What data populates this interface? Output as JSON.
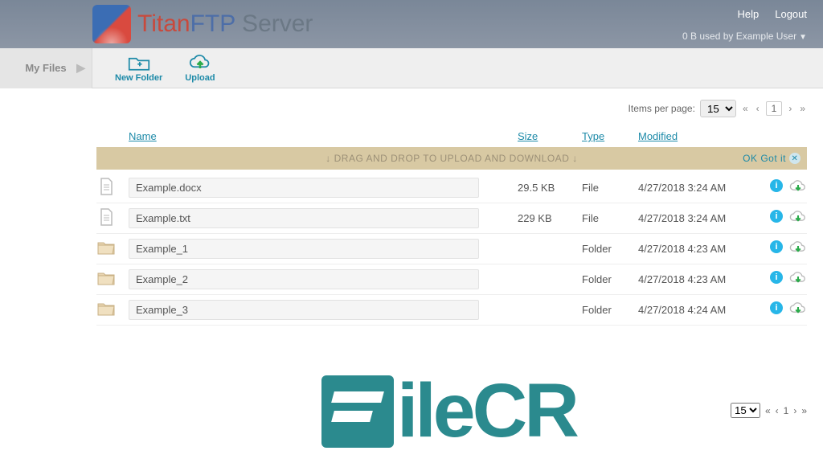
{
  "header": {
    "brand_red": "Titan",
    "brand_blue": "FTP",
    "brand_gray": " Server",
    "help": "Help",
    "logout": "Logout",
    "usage_prefix": "0 B used by ",
    "username": "Example User"
  },
  "sidebar": {
    "my_files": "My Files"
  },
  "toolbar": {
    "new_folder": "New Folder",
    "upload": "Upload"
  },
  "pager": {
    "label": "Items per page:",
    "value": "15",
    "first": "«",
    "prev": "‹",
    "current": "1",
    "next": "›",
    "last": "»"
  },
  "columns": {
    "name": "Name",
    "size": "Size",
    "type": "Type",
    "modified": "Modified"
  },
  "banner": {
    "text": "↓ DRAG AND DROP TO UPLOAD AND DOWNLOAD ↓",
    "ok": "OK Got it"
  },
  "rows": [
    {
      "icon": "file",
      "name": "Example.docx",
      "size": "29.5 KB",
      "type": "File",
      "modified": "4/27/2018 3:24 AM"
    },
    {
      "icon": "file",
      "name": "Example.txt",
      "size": "229 KB",
      "type": "File",
      "modified": "4/27/2018 3:24 AM"
    },
    {
      "icon": "folder",
      "name": "Example_1",
      "size": "",
      "type": "Folder",
      "modified": "4/27/2018 4:23 AM"
    },
    {
      "icon": "folder",
      "name": "Example_2",
      "size": "",
      "type": "Folder",
      "modified": "4/27/2018 4:23 AM"
    },
    {
      "icon": "folder",
      "name": "Example_3",
      "size": "",
      "type": "Folder",
      "modified": "4/27/2018 4:24 AM"
    }
  ],
  "watermark": "ileCR",
  "icons": {
    "info": "i"
  }
}
